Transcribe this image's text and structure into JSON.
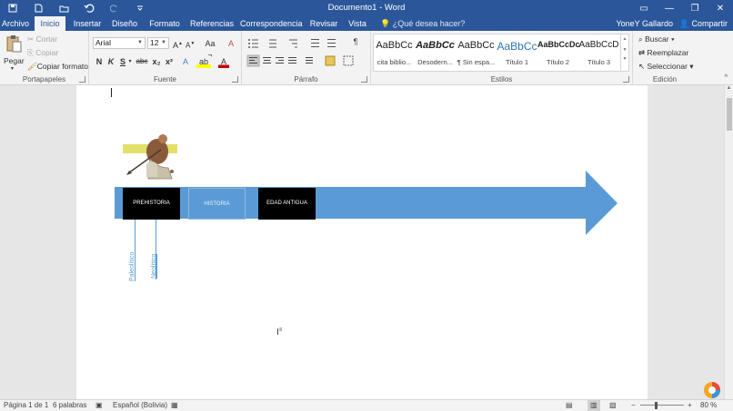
{
  "titlebar": {
    "title": "Documento1 - Word",
    "controls": [
      "▭",
      "—",
      "❐",
      "✕"
    ]
  },
  "tabs": [
    {
      "label": "Archivo",
      "active": false
    },
    {
      "label": "Inicio",
      "active": true
    },
    {
      "label": "Insertar",
      "active": false
    },
    {
      "label": "Diseño",
      "active": false
    },
    {
      "label": "Formato",
      "active": false
    },
    {
      "label": "Referencias",
      "active": false
    },
    {
      "label": "Correspondencia",
      "active": false
    },
    {
      "label": "Revisar",
      "active": false
    },
    {
      "label": "Vista",
      "active": false
    }
  ],
  "tell_me": "¿Qué desea hacer?",
  "user": "YoneY Gallardo",
  "share": "Compartir",
  "ribbon": {
    "clipboard": {
      "paste": "Pegar",
      "cut": "Cortar",
      "copy": "Copiar",
      "format_painter": "Copiar formato",
      "label": "Portapapeles"
    },
    "font": {
      "name": "Arial",
      "size": "12",
      "case": "Aa",
      "bold": "N",
      "italic": "K",
      "underline": "S",
      "strike": "abc",
      "sub": "x₂",
      "sup": "x²",
      "grow": "A",
      "shrink": "A",
      "clear": "A",
      "effects": "A",
      "highlight": "ab",
      "color": "A",
      "label": "Fuente"
    },
    "paragraph": {
      "label": "Párrafo",
      "pilcrow": "¶"
    },
    "styles": {
      "label": "Estilos",
      "items": [
        {
          "sample": "AaBbCc",
          "name": "cita biblio..."
        },
        {
          "sample": "AaBbCc",
          "name": "Desodern..."
        },
        {
          "sample": "AaBbCc",
          "name": "¶ Sin espa..."
        },
        {
          "sample": "AaBbCc",
          "name": "Título 1"
        },
        {
          "sample": "AaBbCcDc",
          "name": "Título 2"
        },
        {
          "sample": "AaBbCcD",
          "name": "Título 3"
        }
      ]
    },
    "editing": {
      "find": "Buscar",
      "replace": "Reemplazar",
      "select": "Seleccionar",
      "label": "Edición"
    }
  },
  "document": {
    "eras": [
      "PREHISTORIA",
      "HISTORIA",
      "EDAD ANTIGUA"
    ],
    "sub_labels": [
      "Paleolítico",
      "Neolítico"
    ]
  },
  "statusbar": {
    "page": "Página 1 de 1",
    "words": "6 palabras",
    "language": "Español (Bolivia)",
    "zoom": "80 %"
  },
  "colors": {
    "word_blue": "#2b579a",
    "arrow_blue": "#5b9bd5"
  }
}
